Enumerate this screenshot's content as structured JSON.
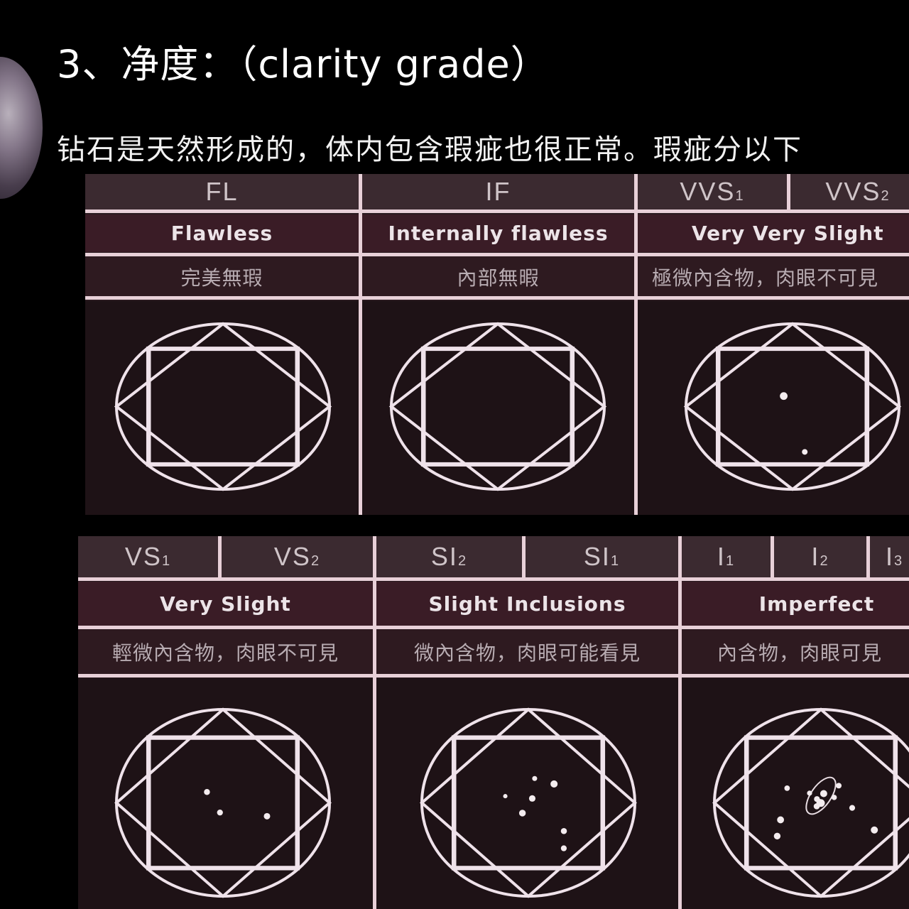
{
  "slide": {
    "title": "3、净度：（clarity grade）",
    "subtitle": "钻石是天然形成的，体内包含瑕疵也很正常。瑕疵分以下"
  },
  "top_row": {
    "groups": [
      {
        "codes": [
          {
            "main": "FL",
            "sub": ""
          }
        ],
        "english": "Flawless",
        "chinese": "完美無瑕",
        "inclusions": 0
      },
      {
        "codes": [
          {
            "main": "IF",
            "sub": ""
          }
        ],
        "english": "Internally flawless",
        "chinese": "內部無暇",
        "inclusions": 0
      },
      {
        "codes": [
          {
            "main": "VVS",
            "sub": "1"
          },
          {
            "main": "VVS",
            "sub": "2"
          }
        ],
        "english": "Very Very Slight",
        "chinese": "極微內含物，肉眼不可見",
        "inclusions": 2
      }
    ]
  },
  "bottom_row": {
    "groups": [
      {
        "codes": [
          {
            "main": "VS",
            "sub": "1"
          },
          {
            "main": "VS",
            "sub": "2"
          }
        ],
        "english": "Very Slight",
        "chinese": "輕微內含物，肉眼不可見",
        "inclusions": 3
      },
      {
        "codes": [
          {
            "main": "SI",
            "sub": "2"
          },
          {
            "main": "SI",
            "sub": "1"
          }
        ],
        "english": "Slight Inclusions",
        "chinese": "微內含物，肉眼可能看見",
        "inclusions": 7
      },
      {
        "codes": [
          {
            "main": "I",
            "sub": "1"
          },
          {
            "main": "I",
            "sub": "2"
          },
          {
            "main": "I",
            "sub": "3"
          }
        ],
        "english": "Imperfect",
        "chinese": "內含物，肉眼可見",
        "inclusions": 14
      }
    ]
  },
  "icons": {
    "diamond": "round-brilliant-diamond-diagram-icon",
    "thumbnail": "diamond-photo-thumbnail"
  }
}
